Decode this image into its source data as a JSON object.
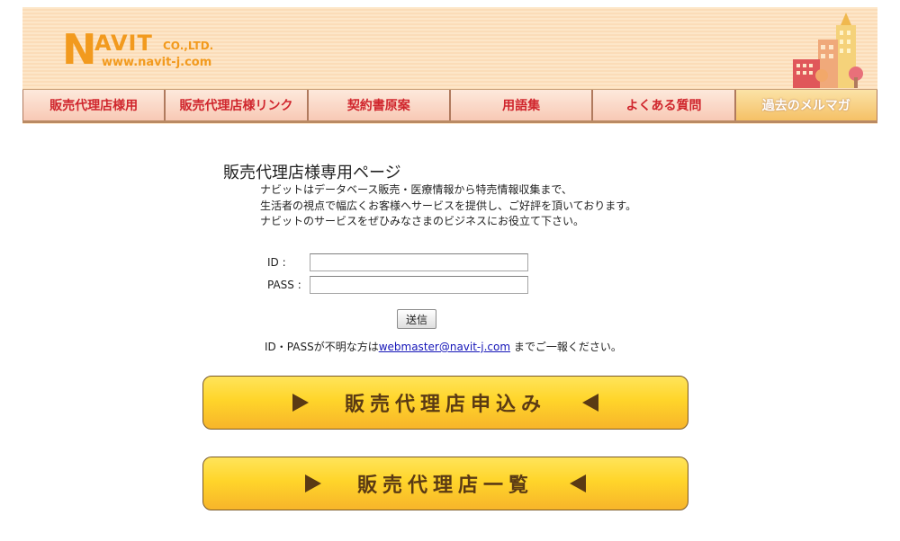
{
  "header": {
    "logo": {
      "n": "N",
      "avit": "AVIT",
      "co": "CO.,LTD.",
      "url": "www.navit-j.com"
    },
    "nav": [
      {
        "label": "販売代理店様用"
      },
      {
        "label": "販売代理店様リンク"
      },
      {
        "label": "契約書原案"
      },
      {
        "label": "用語集"
      },
      {
        "label": "よくある質問"
      },
      {
        "label": "過去のメルマガ"
      }
    ],
    "colors": {
      "nav_text": "#d0262d",
      "active_bg": "#f5c166",
      "logo": "#f29a1e"
    }
  },
  "main": {
    "title": "販売代理店様専用ページ",
    "intro": [
      "ナビットはデータベース販売・医療情報から特売情報収集まで、",
      "生活者の視点で幅広くお客様へサービスを提供し、ご好評を頂いております。",
      "ナビットのサービスをぜひみなさまのビジネスにお役立て下さい。"
    ],
    "form": {
      "id_label": "ID :",
      "pass_label": "PASS :",
      "id_value": "",
      "pass_value": "",
      "submit_label": "送信"
    },
    "note": {
      "prefix": "ID・PASSが不明な方は",
      "email": "webmaster@navit-j.com",
      "suffix": " までご一報ください。"
    },
    "buttons": {
      "apply": "販売代理店申込み",
      "list": "販売代理店一覧"
    }
  }
}
